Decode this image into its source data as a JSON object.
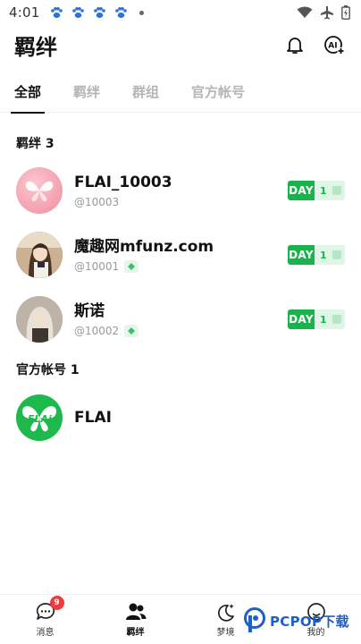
{
  "status_bar": {
    "time": "4:01"
  },
  "header": {
    "title": "羁绊"
  },
  "tabs": [
    {
      "label": "全部",
      "active": true
    },
    {
      "label": "羁绊",
      "active": false
    },
    {
      "label": "群组",
      "active": false
    },
    {
      "label": "官方帐号",
      "active": false
    }
  ],
  "sections": {
    "bonds_title": "羁绊 3",
    "official_title": "官方帐号 1"
  },
  "contacts": [
    {
      "name": "FLAI_10003",
      "handle": "@10003",
      "day_label": "DAY",
      "day_count": "1"
    },
    {
      "name": "魔趣网mfunz.com",
      "handle": "@10001",
      "day_label": "DAY",
      "day_count": "1"
    },
    {
      "name": "斯诺",
      "handle": "@10002",
      "day_label": "DAY",
      "day_count": "1"
    }
  ],
  "official": [
    {
      "name": "FLAI",
      "logo_text": "FLAi"
    }
  ],
  "bottom_nav": [
    {
      "label": "消息",
      "badge": "9",
      "icon": "chat-bubble-icon"
    },
    {
      "label": "羁绊",
      "icon": "people-icon",
      "active": true
    },
    {
      "label": "梦境",
      "icon": "moon-sparkle-icon"
    },
    {
      "label": "我的",
      "icon": "profile-icon"
    }
  ],
  "watermark": {
    "text": "PCPOP下载"
  },
  "colors": {
    "accent_green": "#19b34c",
    "badge_red": "#ee3b3b",
    "tab_inactive": "#b5b5b5"
  }
}
